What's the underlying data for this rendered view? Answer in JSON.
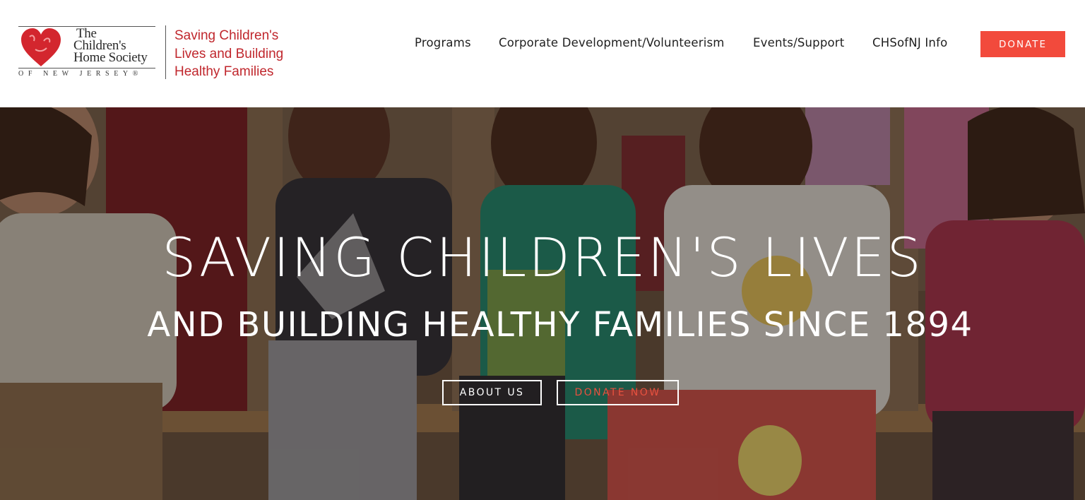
{
  "logo": {
    "name_lines": [
      "The",
      "Children's",
      "Home Society"
    ],
    "state": "OF NEW JERSEY®",
    "tagline_lines": [
      "Saving Children's",
      "Lives and Building",
      "Healthy Families"
    ]
  },
  "nav": {
    "items": [
      {
        "label": "Programs"
      },
      {
        "label": "Corporate Development/Volunteerism"
      },
      {
        "label": "Events/Support"
      },
      {
        "label": "CHSofNJ Info"
      }
    ],
    "donate_label": "DONATE"
  },
  "hero": {
    "title": "SAVING CHILDREN'S LIVES",
    "subtitle": "AND BUILDING HEALTHY FAMILIES SINCE 1894",
    "about_label": "ABOUT US",
    "donate_now_label": "DONATE NOW"
  },
  "colors": {
    "brand_red": "#c0272d",
    "donate_button": "#f24a3c",
    "donate_now_text": "#e8513f",
    "nav_text": "#1f1f1f"
  },
  "icons": [
    "heart-logo-icon"
  ]
}
